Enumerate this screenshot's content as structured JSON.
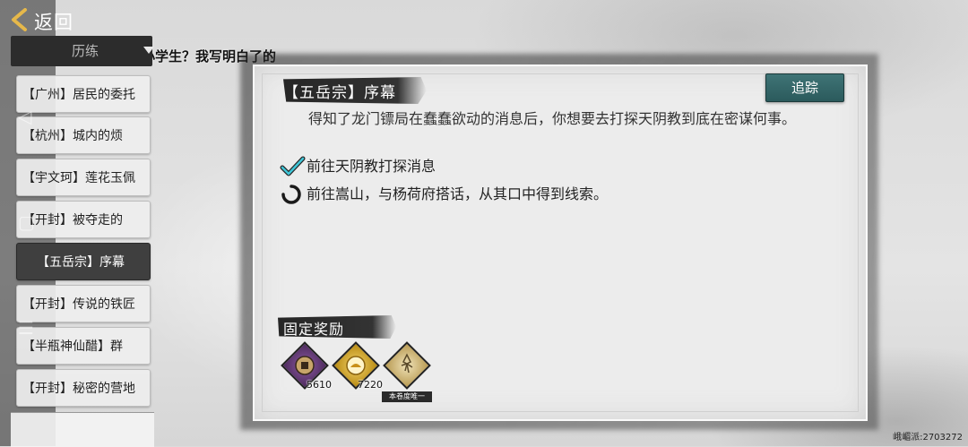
{
  "topbar": {
    "back_label": "返回"
  },
  "video_caption": "小学生？我写明白了的",
  "sidebar": {
    "category_label": "历练",
    "items": [
      {
        "label": "【广州】居民的委托"
      },
      {
        "label": "【杭州】城内的烦"
      },
      {
        "label": "【宇文珂】莲花玉佩"
      },
      {
        "label": "【开封】被夺走的"
      },
      {
        "label": "【五岳宗】序幕"
      },
      {
        "label": "【开封】传说的铁匠"
      },
      {
        "label": "【半瓶神仙醋】群"
      },
      {
        "label": "【开封】秘密的营地"
      }
    ],
    "selected_index": 4
  },
  "quest": {
    "title": "【五岳宗】序幕",
    "track_label": "追踪",
    "description": "得知了龙门镖局在蠢蠢欲动的消息后，你想要去打探天阴教到底在密谋何事。",
    "objectives": [
      {
        "text": "前往天阴教打探消息",
        "status": "completed",
        "icon": "check-icon"
      },
      {
        "text": "前往嵩山，与杨荷府搭话，从其口中得到线索。",
        "status": "in-progress",
        "icon": "progress-ring-icon"
      }
    ]
  },
  "rewards": {
    "label": "固定奖励",
    "items": [
      {
        "icon": "coin-purple-icon",
        "count": "5610",
        "color": "#6a3c7a"
      },
      {
        "icon": "coin-gold-icon",
        "count": "7220",
        "color": "#c99a1e"
      },
      {
        "icon": "scroll-map-icon",
        "count": "",
        "color": "#c9a24a"
      }
    ],
    "tag": "本卷度唯一"
  },
  "watermark": "峨嵋派:2703272"
}
